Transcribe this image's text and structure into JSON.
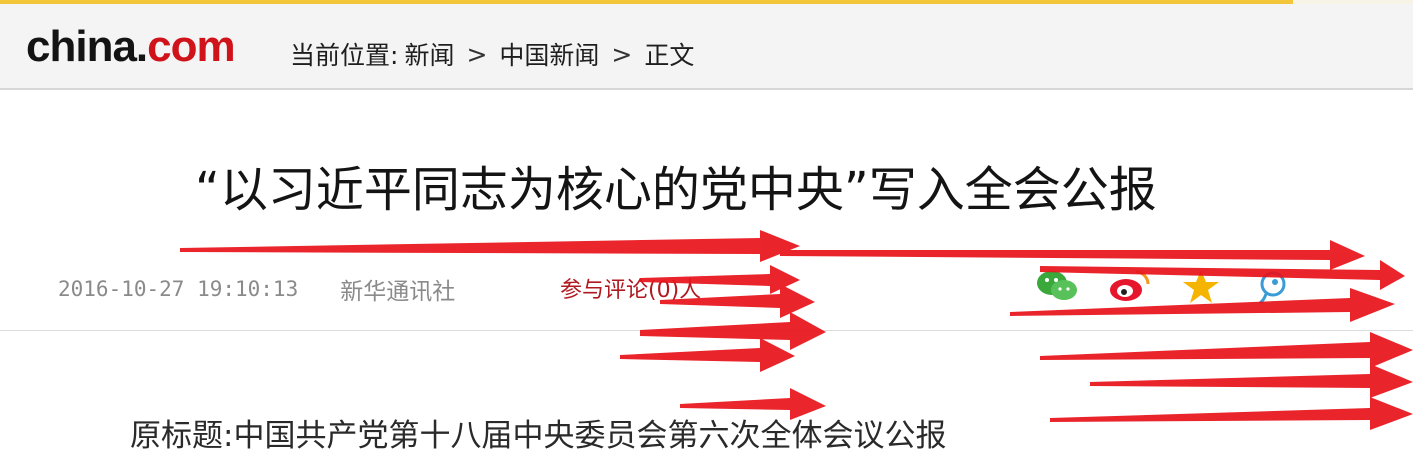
{
  "header": {
    "logo_main": "china.",
    "logo_accent": "com",
    "breadcrumb_label": "当前位置:",
    "breadcrumb_items": [
      "新闻",
      "中国新闻",
      "正文"
    ],
    "separator": ">"
  },
  "article": {
    "title": "“以习近平同志为核心的党中央”写入全会公报",
    "datetime": "2016-10-27 19:10:13",
    "source": "新华通讯社",
    "comments": "参与评论(0)人",
    "original_title": "原标题:中国共产党第十八届中央委员会第六次全体会议公报"
  },
  "share": {
    "icons": [
      "wechat-icon",
      "weibo-icon",
      "qzone-icon",
      "tencent-weibo-icon"
    ]
  },
  "colors": {
    "brand_red": "#d0121b",
    "arrow_red": "#e8141b",
    "top_strip": "#f3c63a"
  }
}
